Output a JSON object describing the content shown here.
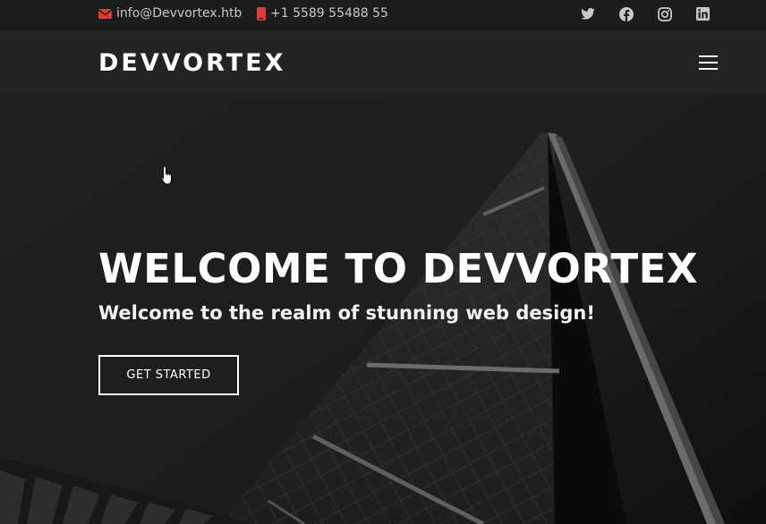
{
  "topbar": {
    "email": "info@Devvortex.htb",
    "phone": "+1 5589 55488 55",
    "socials": [
      {
        "name": "twitter",
        "icon": "twitter-icon"
      },
      {
        "name": "facebook",
        "icon": "facebook-icon"
      },
      {
        "name": "instagram",
        "icon": "instagram-icon"
      },
      {
        "name": "linkedin",
        "icon": "linkedin-icon"
      }
    ]
  },
  "header": {
    "logo": "DEVVORTEX",
    "menu_icon": "hamburger-menu-icon"
  },
  "hero": {
    "title": "WELCOME TO DEVVORTEX",
    "subtitle": "Welcome to the realm of stunning web design!",
    "cta_label": "GET STARTED"
  },
  "colors": {
    "topbar_bg": "#1c1c1c",
    "header_bg": "#242424",
    "accent_red": "#e03a3a",
    "text_white": "#ffffff"
  }
}
